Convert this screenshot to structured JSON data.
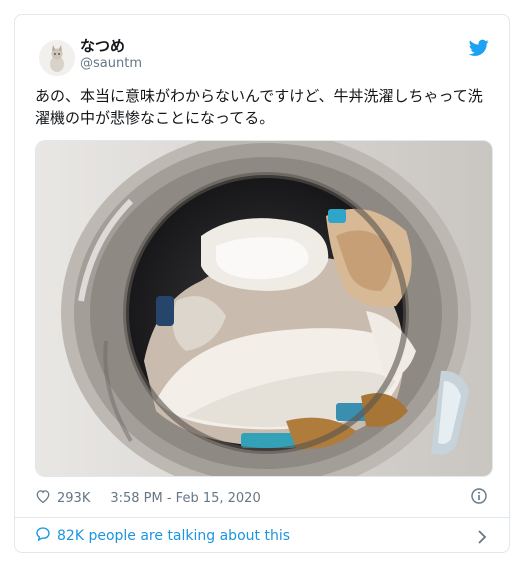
{
  "tweet": {
    "display_name": "なつめ",
    "handle": "@sauntm",
    "text": "あの、本当に意味がわからないんですけど、牛丼洗濯しちゃって洗濯機の中が悲惨なことになってる。",
    "likes": "293K",
    "timestamp": "3:58 PM - Feb 15, 2020",
    "talking": "82K people are talking about this"
  },
  "icons": {
    "brand": "twitter-bird-icon",
    "like": "heart-icon",
    "info": "info-icon",
    "comment": "comment-bubble-icon",
    "chevron": "chevron-right-icon"
  },
  "colors": {
    "link": "#1b95e0",
    "muted": "#657786",
    "text": "#14171a",
    "border": "#e1e8ed"
  }
}
